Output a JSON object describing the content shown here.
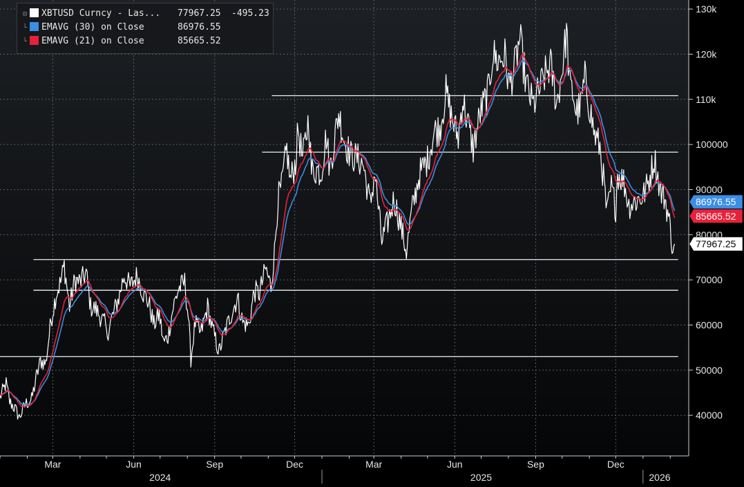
{
  "legend": {
    "items": [
      {
        "name": "XBTUSD Curncy - Las...",
        "value": "77967.25",
        "change": "-495.23",
        "color": "#ffffff"
      },
      {
        "name": "EMAVG (30)  on Close",
        "value": "86976.55",
        "color": "#3a8ee6"
      },
      {
        "name": "EMAVG (21)  on Close",
        "value": "85665.52",
        "color": "#e8213a"
      }
    ]
  },
  "value_tags": {
    "ema30": {
      "text": "86976.55",
      "color": "#3a8ee6"
    },
    "ema21": {
      "text": "85665.52",
      "color": "#e8213a"
    },
    "last": {
      "text": "77967.25",
      "color": "#ffffff"
    }
  },
  "chart_data": {
    "type": "line",
    "title": "",
    "xlabel": "",
    "ylabel": "",
    "ylim": [
      31000,
      132000
    ],
    "y_ticks": [
      40000,
      50000,
      60000,
      70000,
      80000,
      90000,
      100000,
      110000,
      120000,
      130000
    ],
    "y_tick_labels": [
      "40000",
      "50000",
      "60000",
      "70000",
      "80000",
      "90000",
      "100000",
      "110k",
      "120k",
      "130k"
    ],
    "x_month_labels": [
      {
        "label": "Mar",
        "date": "2024-03-01"
      },
      {
        "label": "Jun",
        "date": "2024-06-01"
      },
      {
        "label": "Sep",
        "date": "2024-09-01"
      },
      {
        "label": "Dec",
        "date": "2024-12-01"
      },
      {
        "label": "Mar",
        "date": "2025-03-01"
      },
      {
        "label": "Jun",
        "date": "2025-06-01"
      },
      {
        "label": "Sep",
        "date": "2025-09-01"
      },
      {
        "label": "Dec",
        "date": "2025-12-01"
      }
    ],
    "x_year_labels": [
      {
        "label": "2024",
        "date": "2024-07-01"
      },
      {
        "label": "2025",
        "date": "2025-07-01"
      },
      {
        "label": "2026",
        "date": "2026-01-20"
      }
    ],
    "grid": true,
    "legend_position": "top-left",
    "horizontal_levels": [
      {
        "y": 53000,
        "from": "2024-01-01",
        "to": "2026-02-10"
      },
      {
        "y": 67700,
        "from": "2024-02-08",
        "to": "2026-02-10"
      },
      {
        "y": 74500,
        "from": "2024-02-08",
        "to": "2026-02-10"
      },
      {
        "y": 98300,
        "from": "2024-10-25",
        "to": "2026-02-10"
      },
      {
        "y": 110800,
        "from": "2024-11-05",
        "to": "2026-02-10"
      }
    ],
    "series": [
      {
        "name": "XBTUSD Curncy - Las...",
        "color": "#ffffff",
        "points": [
          [
            "2024-01-01",
            44000
          ],
          [
            "2024-01-08",
            47000
          ],
          [
            "2024-01-12",
            43000
          ],
          [
            "2024-01-18",
            41500
          ],
          [
            "2024-01-23",
            39500
          ],
          [
            "2024-01-30",
            42500
          ],
          [
            "2024-02-06",
            43500
          ],
          [
            "2024-02-12",
            49000
          ],
          [
            "2024-02-16",
            52000
          ],
          [
            "2024-02-22",
            51500
          ],
          [
            "2024-02-28",
            61000
          ],
          [
            "2024-03-05",
            67000
          ],
          [
            "2024-03-10",
            69500
          ],
          [
            "2024-03-14",
            73200
          ],
          [
            "2024-03-20",
            64000
          ],
          [
            "2024-03-26",
            70000
          ],
          [
            "2024-04-01",
            69500
          ],
          [
            "2024-04-08",
            71500
          ],
          [
            "2024-04-13",
            64000
          ],
          [
            "2024-04-19",
            63500
          ],
          [
            "2024-04-30",
            60000
          ],
          [
            "2024-05-01",
            57500
          ],
          [
            "2024-05-08",
            62000
          ],
          [
            "2024-05-15",
            66000
          ],
          [
            "2024-05-21",
            71000
          ],
          [
            "2024-05-28",
            68500
          ],
          [
            "2024-06-05",
            71000
          ],
          [
            "2024-06-12",
            67000
          ],
          [
            "2024-06-18",
            65000
          ],
          [
            "2024-06-24",
            60000
          ],
          [
            "2024-06-30",
            62500
          ],
          [
            "2024-07-05",
            56000
          ],
          [
            "2024-07-10",
            57500
          ],
          [
            "2024-07-16",
            64000
          ],
          [
            "2024-07-22",
            68000
          ],
          [
            "2024-07-29",
            69500
          ],
          [
            "2024-08-02",
            62000
          ],
          [
            "2024-08-05",
            52500
          ],
          [
            "2024-08-10",
            60500
          ],
          [
            "2024-08-16",
            58000
          ],
          [
            "2024-08-24",
            64000
          ],
          [
            "2024-08-29",
            59500
          ],
          [
            "2024-09-06",
            54000
          ],
          [
            "2024-09-12",
            58000
          ],
          [
            "2024-09-19",
            62000
          ],
          [
            "2024-09-27",
            66000
          ],
          [
            "2024-10-03",
            60500
          ],
          [
            "2024-10-10",
            60000
          ],
          [
            "2024-10-16",
            67500
          ],
          [
            "2024-10-22",
            67000
          ],
          [
            "2024-10-29",
            72500
          ],
          [
            "2024-11-04",
            68500
          ],
          [
            "2024-11-08",
            76000
          ],
          [
            "2024-11-12",
            88000
          ],
          [
            "2024-11-16",
            90500
          ],
          [
            "2024-11-22",
            99000
          ],
          [
            "2024-11-26",
            92000
          ],
          [
            "2024-12-02",
            96000
          ],
          [
            "2024-12-05",
            103500
          ],
          [
            "2024-12-10",
            96500
          ],
          [
            "2024-12-17",
            106000
          ],
          [
            "2024-12-20",
            94000
          ],
          [
            "2024-12-27",
            94500
          ],
          [
            "2024-12-31",
            93500
          ],
          [
            "2025-01-06",
            102000
          ],
          [
            "2025-01-10",
            94500
          ],
          [
            "2025-01-20",
            107000
          ],
          [
            "2025-01-27",
            100500
          ],
          [
            "2025-02-03",
            97500
          ],
          [
            "2025-02-10",
            97000
          ],
          [
            "2025-02-17",
            95500
          ],
          [
            "2025-02-25",
            86500
          ],
          [
            "2025-03-02",
            94000
          ],
          [
            "2025-03-10",
            78500
          ],
          [
            "2025-03-18",
            83500
          ],
          [
            "2025-03-24",
            88000
          ],
          [
            "2025-03-31",
            82500
          ],
          [
            "2025-04-07",
            76300
          ],
          [
            "2025-04-13",
            85000
          ],
          [
            "2025-04-22",
            93500
          ],
          [
            "2025-05-01",
            96500
          ],
          [
            "2025-05-09",
            103000
          ],
          [
            "2025-05-15",
            103500
          ],
          [
            "2025-05-22",
            111500
          ],
          [
            "2025-05-29",
            105500
          ],
          [
            "2025-06-05",
            101500
          ],
          [
            "2025-06-10",
            110000
          ],
          [
            "2025-06-22",
            99000
          ],
          [
            "2025-06-30",
            107000
          ],
          [
            "2025-07-09",
            111500
          ],
          [
            "2025-07-14",
            120000
          ],
          [
            "2025-07-20",
            118500
          ],
          [
            "2025-07-28",
            119500
          ],
          [
            "2025-08-02",
            113000
          ],
          [
            "2025-08-08",
            117000
          ],
          [
            "2025-08-14",
            123500
          ],
          [
            "2025-08-21",
            113500
          ],
          [
            "2025-08-29",
            108500
          ],
          [
            "2025-09-05",
            112000
          ],
          [
            "2025-09-12",
            115500
          ],
          [
            "2025-09-18",
            117500
          ],
          [
            "2025-09-25",
            109000
          ],
          [
            "2025-10-01",
            116500
          ],
          [
            "2025-10-06",
            125000
          ],
          [
            "2025-10-10",
            112500
          ],
          [
            "2025-10-14",
            111000
          ],
          [
            "2025-10-17",
            107000
          ],
          [
            "2025-10-22",
            108500
          ],
          [
            "2025-10-27",
            114500
          ],
          [
            "2025-11-03",
            106500
          ],
          [
            "2025-11-07",
            102000
          ],
          [
            "2025-11-13",
            99500
          ],
          [
            "2025-11-17",
            92500
          ],
          [
            "2025-11-21",
            84500
          ],
          [
            "2025-11-26",
            90500
          ],
          [
            "2025-12-01",
            86000
          ],
          [
            "2025-12-03",
            93500
          ],
          [
            "2025-12-10",
            92000
          ],
          [
            "2025-12-16",
            86500
          ],
          [
            "2025-12-24",
            87500
          ],
          [
            "2026-01-01",
            88500
          ],
          [
            "2026-01-07",
            91500
          ],
          [
            "2026-01-14",
            97000
          ],
          [
            "2026-01-21",
            89500
          ],
          [
            "2026-01-26",
            88000
          ],
          [
            "2026-01-30",
            84000
          ],
          [
            "2026-02-03",
            78500
          ],
          [
            "2026-02-05",
            75500
          ],
          [
            "2026-02-06",
            77967.25
          ]
        ]
      },
      {
        "name": "EMAVG (30)  on Close",
        "color": "#3a8ee6",
        "ema_period": 30,
        "last": 86976.55
      },
      {
        "name": "EMAVG (21)  on Close",
        "color": "#e8213a",
        "ema_period": 21,
        "last": 85665.52
      }
    ]
  }
}
